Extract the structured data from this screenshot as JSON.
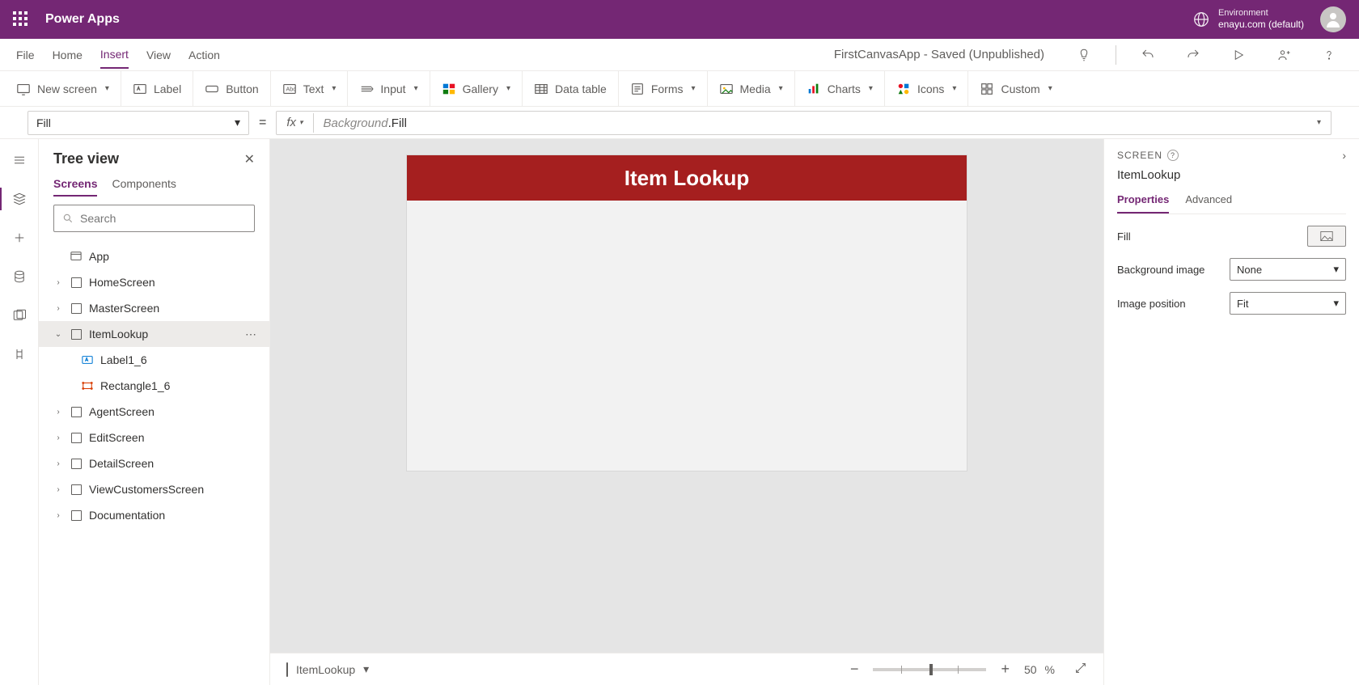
{
  "header": {
    "appName": "Power Apps",
    "envLabel": "Environment",
    "envName": "enayu.com (default)"
  },
  "menubar": {
    "items": [
      "File",
      "Home",
      "Insert",
      "View",
      "Action"
    ],
    "activeIndex": 2,
    "titleSaved": "FirstCanvasApp - Saved (Unpublished)"
  },
  "ribbon": {
    "newScreen": "New screen",
    "label": "Label",
    "button": "Button",
    "text": "Text",
    "input": "Input",
    "gallery": "Gallery",
    "dataTable": "Data table",
    "forms": "Forms",
    "media": "Media",
    "charts": "Charts",
    "icons": "Icons",
    "custom": "Custom"
  },
  "formula": {
    "property": "Fill",
    "fxPrefix": "Background",
    "fxSuffix": ".Fill"
  },
  "treeview": {
    "title": "Tree view",
    "tabs": [
      "Screens",
      "Components"
    ],
    "activeTab": 0,
    "searchPlaceholder": "Search",
    "app": "App",
    "screens": [
      {
        "name": "HomeScreen",
        "expanded": false
      },
      {
        "name": "MasterScreen",
        "expanded": false
      },
      {
        "name": "ItemLookup",
        "expanded": true,
        "selected": true,
        "children": [
          {
            "name": "Label1_6",
            "type": "label"
          },
          {
            "name": "Rectangle1_6",
            "type": "rect"
          }
        ]
      },
      {
        "name": "AgentScreen",
        "expanded": false
      },
      {
        "name": "EditScreen",
        "expanded": false
      },
      {
        "name": "DetailScreen",
        "expanded": false
      },
      {
        "name": "ViewCustomersScreen",
        "expanded": false
      },
      {
        "name": "Documentation",
        "expanded": false
      }
    ]
  },
  "canvas": {
    "headerText": "Item Lookup",
    "headerBg": "#a51f1f",
    "footer": {
      "screenName": "ItemLookup",
      "zoom": "50",
      "zoomUnit": "%"
    }
  },
  "properties": {
    "type": "SCREEN",
    "name": "ItemLookup",
    "tabs": [
      "Properties",
      "Advanced"
    ],
    "activeTab": 0,
    "rows": {
      "fill": "Fill",
      "bgImage": "Background image",
      "bgImageVal": "None",
      "imgPos": "Image position",
      "imgPosVal": "Fit"
    }
  }
}
